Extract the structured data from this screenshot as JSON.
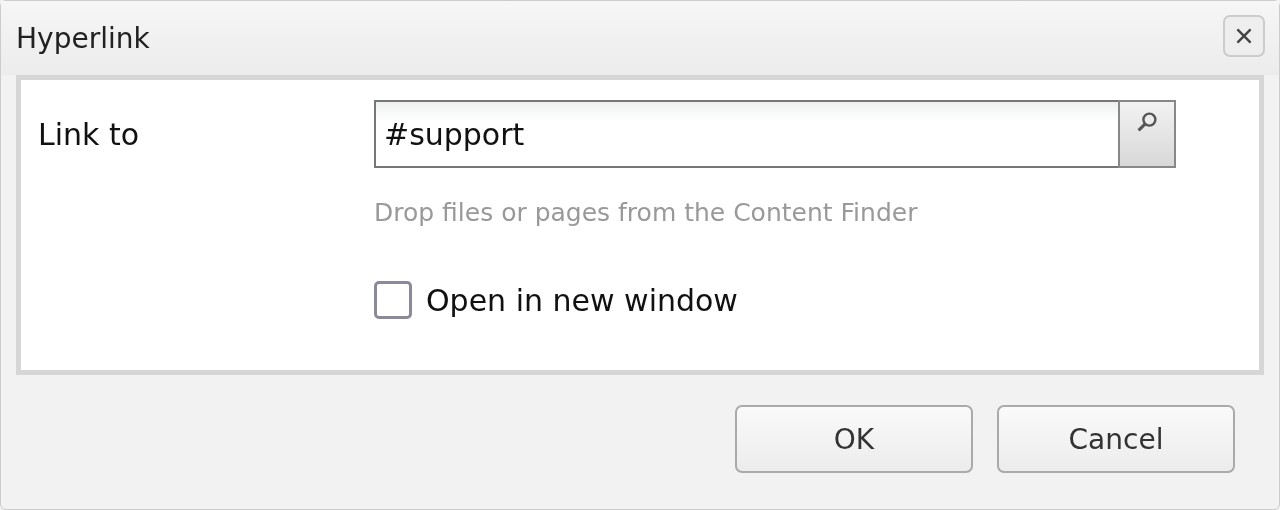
{
  "window": {
    "title": "Hyperlink"
  },
  "form": {
    "link_label": "Link to",
    "link_field": {
      "value": "#support"
    },
    "hint": "Drop files or pages from the Content Finder",
    "new_window": {
      "label": "Open in new window",
      "checked": false
    }
  },
  "buttons": [
    {
      "label": "OK"
    },
    {
      "label": "Cancel"
    }
  ]
}
